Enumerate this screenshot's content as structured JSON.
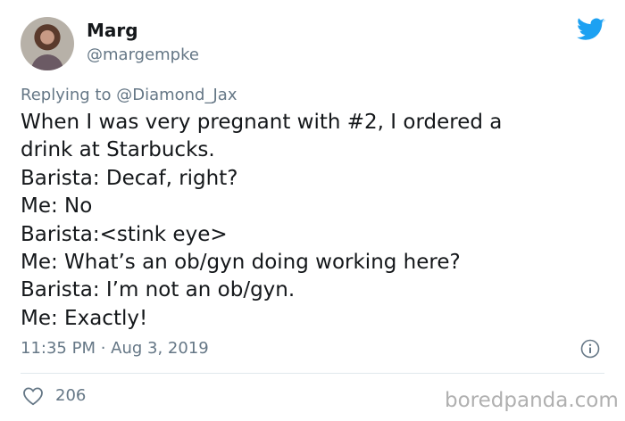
{
  "author": {
    "name": "Marg",
    "handle": "@margempke"
  },
  "reply": {
    "prefix": "Replying to ",
    "to_handle": "@Diamond_Jax"
  },
  "tweet": {
    "lines": [
      "When I was very pregnant with #2, I ordered a",
      "drink at Starbucks.",
      "Barista: Decaf, right?",
      "Me: No",
      "Barista:<stink eye>",
      "Me: What’s an ob/gyn doing working here?",
      "Barista: I’m not an ob/gyn.",
      "Me: Exactly!"
    ]
  },
  "meta": {
    "time": "11:35 PM",
    "separator": " · ",
    "date": "Aug 3, 2019"
  },
  "engagement": {
    "likes": "206"
  },
  "watermark": "boredpanda.com",
  "colors": {
    "twitter_blue": "#1da1f2",
    "secondary_text": "#657786",
    "primary_text": "#14171a"
  },
  "icons": {
    "brand": "twitter-bird-icon",
    "info": "info-icon",
    "like": "heart-outline-icon"
  }
}
